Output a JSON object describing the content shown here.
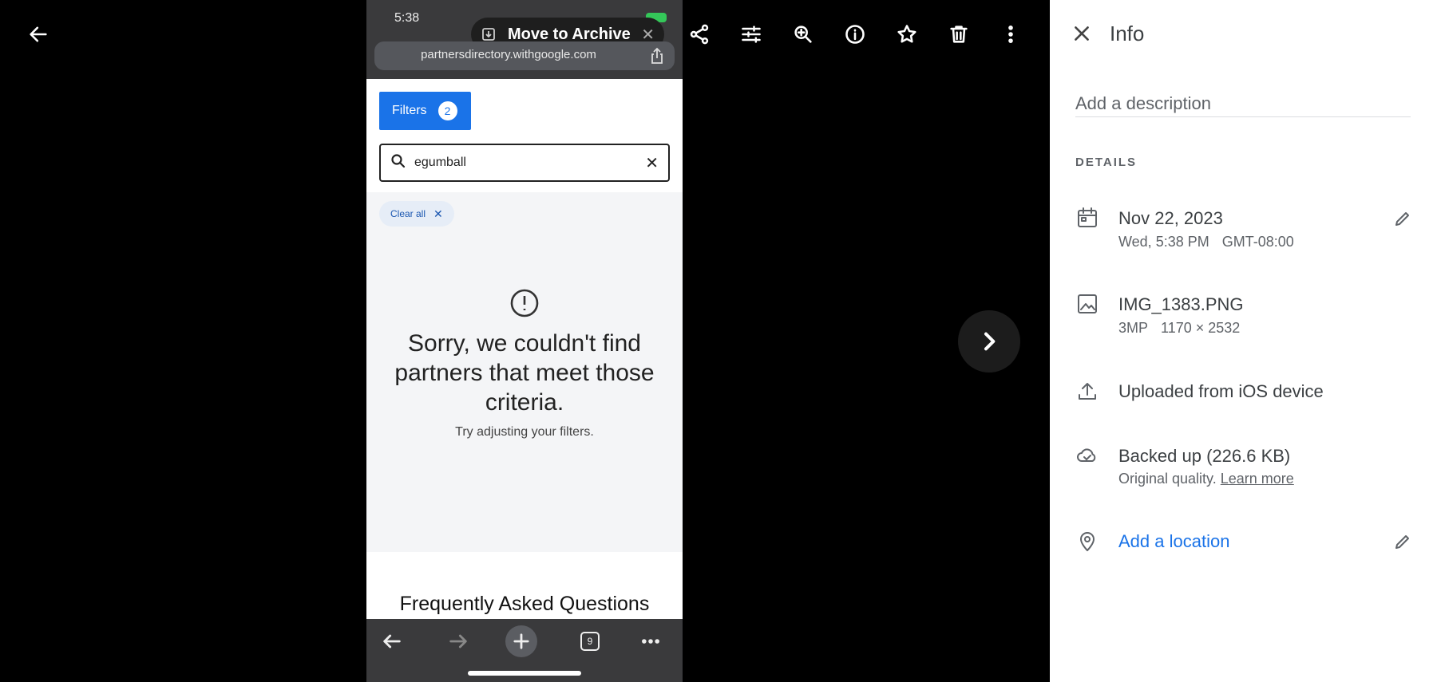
{
  "viewer": {
    "toolbar_icons": [
      "arrow-back-icon",
      "share-icon",
      "tune-icon",
      "zoom-in-icon",
      "info-icon",
      "star-icon",
      "trash-icon",
      "more-vert-icon"
    ],
    "next_icon": "chevron-right-icon"
  },
  "phone": {
    "time": "5:38",
    "toast": {
      "label": "Move to Archive",
      "close": "✕"
    },
    "url": "partnersdirectory.withgoogle.com",
    "filters": {
      "label": "Filters",
      "count": "2"
    },
    "search": {
      "value": "egumball",
      "clear": "✕"
    },
    "clear_all": {
      "label": "Clear all",
      "x": "✕"
    },
    "empty_state": {
      "title": "Sorry, we couldn't find partners that meet those criteria.",
      "hint": "Try adjusting your filters."
    },
    "faq_title": "Frequently Asked Questions",
    "tab_count": "9"
  },
  "info": {
    "title": "Info",
    "description_placeholder": "Add a description",
    "details_heading": "DETAILS",
    "date": {
      "main": "Nov 22, 2023",
      "day_time": "Wed, 5:38 PM",
      "timezone": "GMT-08:00"
    },
    "file": {
      "name": "IMG_1383.PNG",
      "megapixels": "3MP",
      "dimensions": "1170 × 2532"
    },
    "upload": {
      "text": "Uploaded from iOS device"
    },
    "backup": {
      "main": "Backed up (226.6 KB)",
      "quality": "Original quality.",
      "learn_more": "Learn more"
    },
    "location": {
      "label": "Add a location"
    }
  },
  "colors": {
    "accent": "#1a73e8",
    "panel_bg": "#ffffff",
    "viewer_bg": "#000000"
  }
}
